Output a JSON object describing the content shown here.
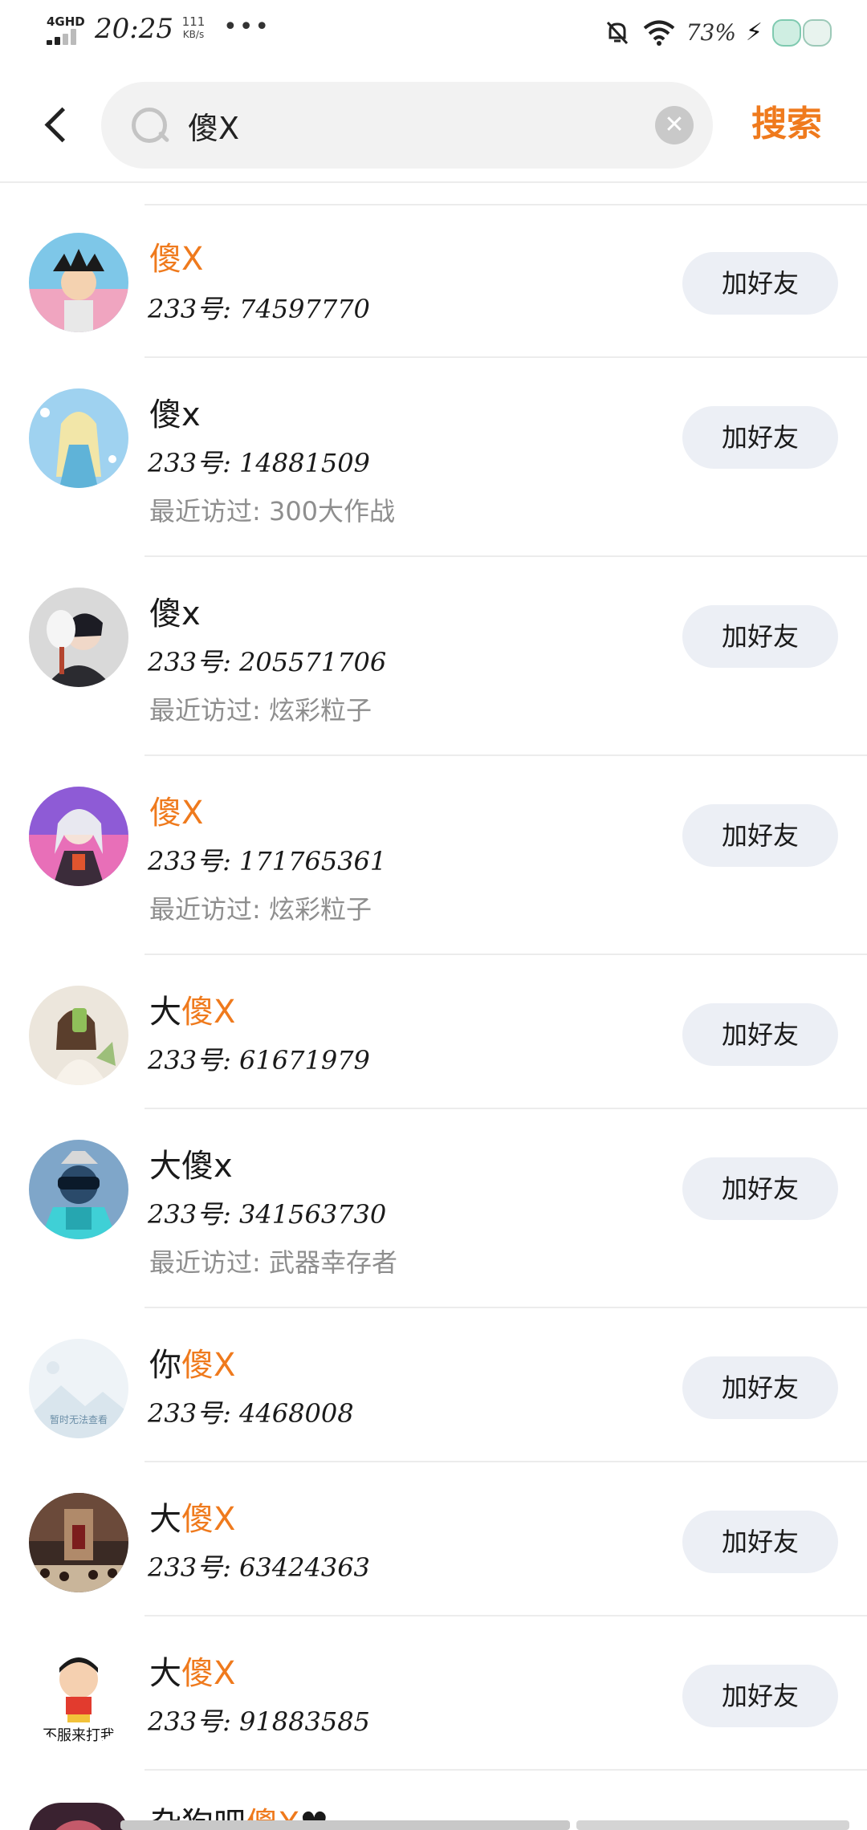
{
  "status_bar": {
    "network": "4GHD",
    "time": "20:25",
    "speed_value": "111",
    "speed_unit": "KB/s",
    "more": "•••",
    "battery": "73%",
    "icons": [
      "signal-icon",
      "mute-bell-icon",
      "wifi-icon",
      "charging-icon",
      "mascot-sticker-icon"
    ]
  },
  "header": {
    "search_query": "傻X",
    "search_button": "搜索"
  },
  "colors": {
    "accent": "#ef7a1d",
    "button_bg": "#eceff5",
    "secondary_text": "#8e8e8e"
  },
  "results": [
    {
      "name_prefix": "",
      "name_highlight": "傻X",
      "name_suffix": "",
      "uid": "233号: 74597770",
      "recent": "",
      "button": "加好友",
      "avatar": "cartoon-boy-avatar"
    },
    {
      "name_prefix": "傻x",
      "name_highlight": "",
      "name_suffix": "",
      "uid": "233号: 14881509",
      "recent": "最近访过: 300大作战",
      "button": "加好友",
      "avatar": "ice-princess-avatar"
    },
    {
      "name_prefix": "傻x",
      "name_highlight": "",
      "name_suffix": "",
      "uid": "233号: 205571706",
      "recent": "最近访过: 炫彩粒子",
      "button": "加好友",
      "avatar": "masked-boy-avatar"
    },
    {
      "name_prefix": "",
      "name_highlight": "傻X",
      "name_suffix": "",
      "uid": "233号: 171765361",
      "recent": "最近访过: 炫彩粒子",
      "button": "加好友",
      "avatar": "anime-girl-avatar"
    },
    {
      "name_prefix": "大",
      "name_highlight": "傻X",
      "name_suffix": "",
      "uid": "233号: 61671979",
      "recent": "",
      "button": "加好友",
      "avatar": "selfie-girl-avatar"
    },
    {
      "name_prefix": "大傻x",
      "name_highlight": "",
      "name_suffix": "",
      "uid": "233号: 341563730",
      "recent": "最近访过: 武器幸存者",
      "button": "加好友",
      "avatar": "robot-hero-avatar"
    },
    {
      "name_prefix": "你",
      "name_highlight": "傻X",
      "name_suffix": "",
      "uid": "233号: 4468008",
      "recent": "",
      "button": "加好友",
      "avatar": "placeholder-avatar",
      "avatar_caption": "暂时无法查看"
    },
    {
      "name_prefix": "大",
      "name_highlight": "傻X",
      "name_suffix": "",
      "uid": "233号: 63424363",
      "recent": "",
      "button": "加好友",
      "avatar": "dark-crowd-avatar"
    },
    {
      "name_prefix": "大",
      "name_highlight": "傻X",
      "name_suffix": "",
      "uid": "233号: 91883585",
      "recent": "",
      "button": "加好友",
      "avatar": "crayon-kid-avatar",
      "avatar_caption": "不服来打我"
    },
    {
      "name_prefix": "杂狗吧",
      "name_highlight": "傻X",
      "name_suffix": "♥",
      "uid": "",
      "recent": "",
      "button": "",
      "avatar": "partial-avatar"
    }
  ]
}
